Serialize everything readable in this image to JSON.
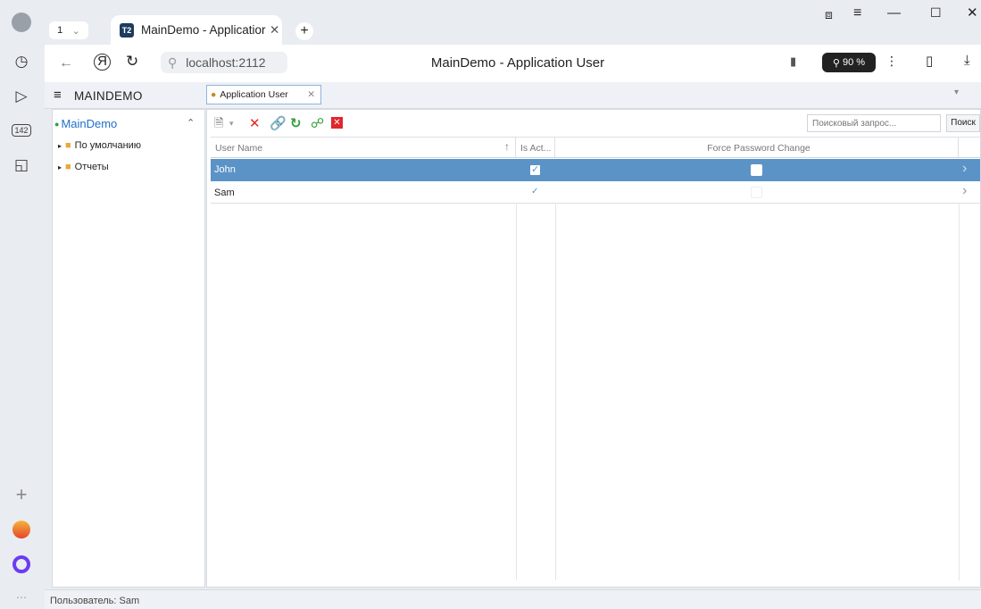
{
  "browser": {
    "tab_counter": "1",
    "tab_title": "MainDemo - Applicatior",
    "favicon_text": "T2",
    "address": "localhost:2112",
    "page_title": "MainDemo - Application User",
    "zoom": "90 %",
    "sidebar_badge": "142"
  },
  "app": {
    "brand": "MAINDEMO",
    "doc_tab_label": "Application User",
    "search_placeholder": "Поисковый запрос...",
    "search_button": "Поиск",
    "status_text": "Пользователь: Sam"
  },
  "nav": {
    "root": "MainDemo",
    "items": [
      {
        "label": "По умолчанию"
      },
      {
        "label": "Отчеты"
      }
    ]
  },
  "grid": {
    "columns": [
      "User Name",
      "Is Act...",
      "Force Password Change"
    ],
    "rows": [
      {
        "name": "John",
        "is_active": true,
        "force_change": false,
        "selected": true
      },
      {
        "name": "Sam",
        "is_active": true,
        "force_change": false,
        "selected": false
      }
    ]
  },
  "colors": {
    "selection": "#5b93c7",
    "delete": "#e0262a",
    "refresh": "#2f9d37",
    "accent": "#1f6fcc"
  }
}
